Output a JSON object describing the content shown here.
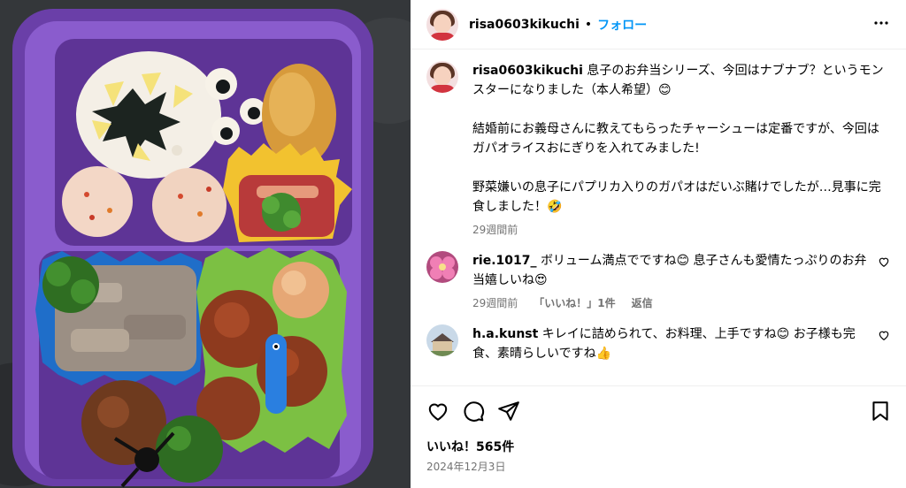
{
  "post": {
    "username": "risa0603kikuchi",
    "dot": "•",
    "follow_label": "フォロー",
    "caption_username": "risa0603kikuchi",
    "caption_text": "息子のお弁当シリーズ、今回はナブナブ？というモンスターになりました（本人希望）😊\n\n結婚前にお義母さんに教えてもらったチャーシューは定番ですが、今回はガパオライスおにぎりを入れてみました!\n\n野菜嫌いの息子にパプリカ入りのガパオはだいぶ賭けでしたが…見事に完食しました！🤣",
    "caption_time": "29週間前",
    "likes": "いいね！565件",
    "date": "2024年12月3日"
  },
  "comments": [
    {
      "username": "rie.1017_",
      "text": "ボリューム満点でですね😊 息子さんも愛情たっぷりのお弁当嬉しいね😍",
      "time": "29週間前",
      "likes_label": "「いいね！」1件",
      "reply_label": "返信"
    },
    {
      "username": "h.a.kunst",
      "text": "キレイに詰められて、お料理、上手ですね😊 お子様も完食、素晴らしいですね👍"
    }
  ],
  "icons": {
    "more": "more-options-icon",
    "heart": "heart-icon",
    "comment": "comment-icon",
    "share": "share-icon",
    "save": "bookmark-icon"
  },
  "colors": {
    "link_blue": "#0095f6",
    "secondary_text": "#737373",
    "bento_box": "#7b4bb8"
  }
}
